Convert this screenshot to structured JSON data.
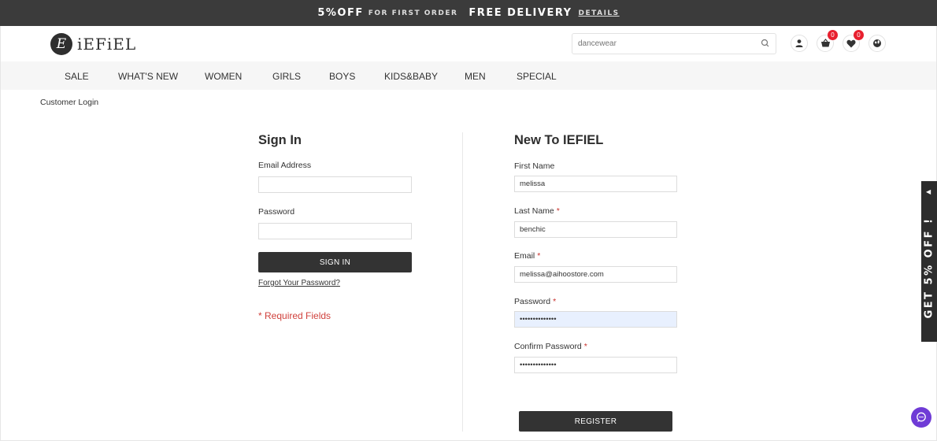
{
  "promo": {
    "big1": "5%OFF",
    "small1": "FOR FIRST ORDER",
    "big2": "FREE DELIVERY",
    "link": "DETAILS"
  },
  "header": {
    "logo_mark": "E",
    "logo_text": "iEFiEL",
    "search_value": "dancewear",
    "cart_count": "0",
    "wishlist_count": "0",
    "icons": [
      "user-icon",
      "cart-icon",
      "heart-icon",
      "globe-icon",
      "search-icon"
    ]
  },
  "nav": {
    "items": [
      "SALE",
      "WHAT'S NEW",
      "WOMEN",
      "GIRLS",
      "BOYS",
      "KIDS&BABY",
      "MEN",
      "SPECIAL"
    ]
  },
  "breadcrumb": "Customer Login",
  "signin": {
    "title": "Sign In",
    "email_label": "Email Address",
    "email_value": "",
    "password_label": "Password",
    "password_value": "",
    "button": "SIGN IN",
    "forgot": "Forgot Your Password?",
    "required_note": "* Required Fields"
  },
  "register": {
    "title": "New To IEFIEL",
    "first_name_label": "First Name",
    "first_name_value": "melissa",
    "last_name_label": "Last Name",
    "last_name_value": "benchic",
    "email_label": "Email",
    "email_value": "melissa@aihoostore.com",
    "password_label": "Password",
    "password_value": "••••••••••••••",
    "confirm_label": "Confirm Password",
    "confirm_value": "••••••••••••••",
    "required_mark": "*",
    "button": "REGISTER"
  },
  "side_tab": {
    "text": "GET 5% OFF !",
    "arrow": "◀"
  },
  "colors": {
    "dark": "#333333",
    "accent_red": "#e8202f",
    "chat_purple": "#6f3bd6",
    "autofill": "#e8f0fe"
  }
}
